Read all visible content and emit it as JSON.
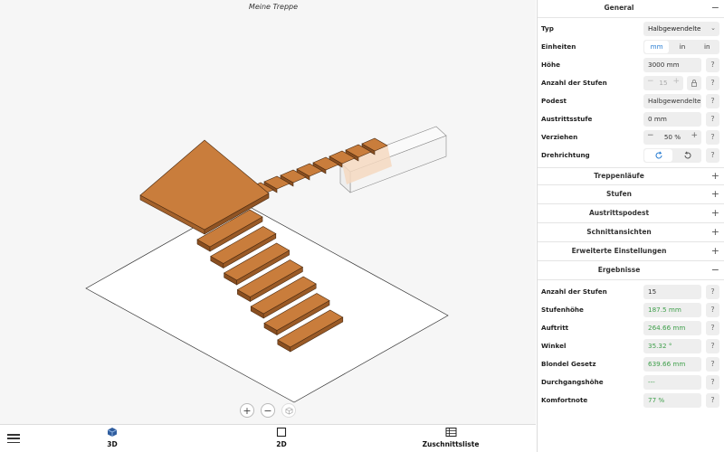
{
  "scene": {
    "title": "Meine Treppe"
  },
  "zoom": {
    "in_label": "+",
    "out_label": "−",
    "reset_icon": "cube-outline-icon"
  },
  "bottom_tabs": [
    {
      "label": "3D",
      "icon": "cube-icon",
      "active": true
    },
    {
      "label": "2D",
      "icon": "square-icon",
      "active": false
    },
    {
      "label": "Zuschnittsliste",
      "icon": "table-icon",
      "active": false
    }
  ],
  "colors": {
    "wood": "#c97d3c",
    "wood_edge": "#4a2a10",
    "accent_blue": "#2a7ed3",
    "result_green": "#3f9f4b"
  },
  "general": {
    "title": "General",
    "toggle": "−",
    "typ": {
      "label": "Typ",
      "value": "Halbgewendelte"
    },
    "einheiten": {
      "label": "Einheiten",
      "options": [
        "mm",
        "in",
        "in"
      ],
      "selected": "mm"
    },
    "hoehe": {
      "label": "Höhe",
      "value": "3000 mm"
    },
    "stufen": {
      "label": "Anzahl der Stufen",
      "value": "15"
    },
    "podest": {
      "label": "Podest",
      "value": "Halbgewendelte"
    },
    "austritt": {
      "label": "Austrittsstufe",
      "value": "0 mm"
    },
    "verziehen": {
      "label": "Verziehen",
      "value": "50 %",
      "minus": "−",
      "plus": "+"
    },
    "dreh": {
      "label": "Drehrichtung"
    },
    "help": "?"
  },
  "sections": [
    {
      "title": "Treppenläufe",
      "toggle": "+"
    },
    {
      "title": "Stufen",
      "toggle": "+"
    },
    {
      "title": "Austrittspodest",
      "toggle": "+"
    },
    {
      "title": "Schnittansichten",
      "toggle": "+"
    },
    {
      "title": "Erweiterte Einstellungen",
      "toggle": "+"
    }
  ],
  "results": {
    "title": "Ergebnisse",
    "toggle": "−",
    "rows": [
      {
        "label": "Anzahl der Stufen",
        "value": "15",
        "green": false
      },
      {
        "label": "Stufenhöhe",
        "value": "187.5 mm",
        "green": true
      },
      {
        "label": "Auftritt",
        "value": "264.66 mm",
        "green": true
      },
      {
        "label": "Winkel",
        "value": "35.32 °",
        "green": true
      },
      {
        "label": "Blondel Gesetz",
        "value": "639.66 mm",
        "green": true
      },
      {
        "label": "Durchgangshöhe",
        "value": "---",
        "green": true
      },
      {
        "label": "Komfortnote",
        "value": "77 %",
        "green": true
      }
    ]
  }
}
